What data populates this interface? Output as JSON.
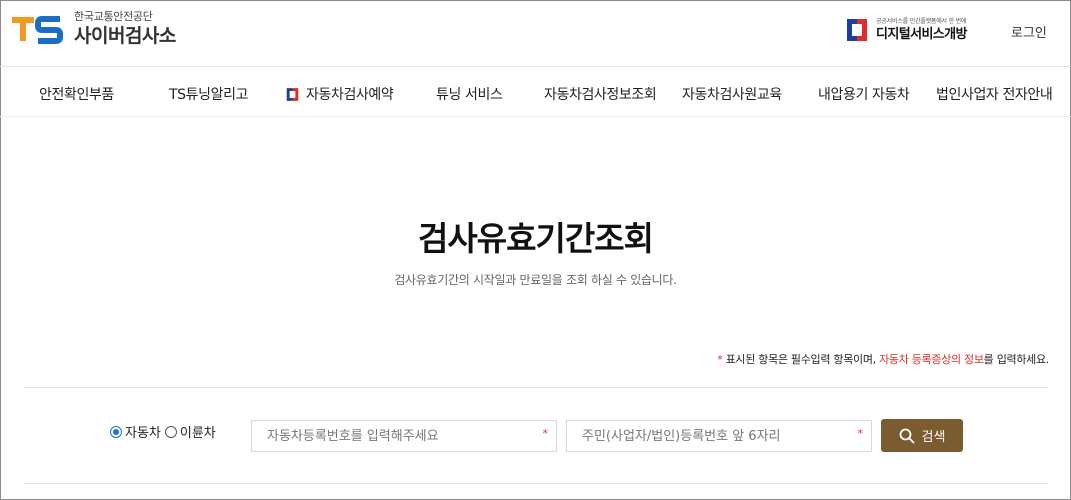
{
  "header": {
    "logo_mark": "TS",
    "org_name": "한국교통안전공단",
    "site_name": "사이버검사소",
    "digital_tagline": "공공서비스를 민간플랫폼에서 한 번에",
    "digital_name": "디지털서비스개방",
    "login_label": "로그인"
  },
  "nav": {
    "items": [
      {
        "label": "안전확인부품"
      },
      {
        "label": "TS튜닝알리고"
      },
      {
        "label": "자동차검사예약",
        "icon": "digital-service-icon"
      },
      {
        "label": "튜닝 서비스"
      },
      {
        "label": "자동차검사정보조회"
      },
      {
        "label": "자동차검사원교육"
      },
      {
        "label": "내압용기 자동차"
      },
      {
        "label": "법인사업자 전자안내"
      }
    ]
  },
  "main": {
    "title": "검사유효기간조회",
    "subtitle": "검사유효기간의 시작일과 만료일을 조회 하실 수 있습니다.",
    "notice": {
      "star": "*",
      "text_before": " 표시된 항목은 필수입력 항목이며, ",
      "highlight": "자동차 등록증상의 정보",
      "text_after": "를 입력하세요."
    }
  },
  "form": {
    "vehicle_types": [
      {
        "label": "자동차",
        "checked": true
      },
      {
        "label": "이륜차",
        "checked": false
      }
    ],
    "car_number": {
      "placeholder": "자동차등록번호를 입력해주세요",
      "value": "",
      "required_mark": "*"
    },
    "id_number": {
      "placeholder": "주민(사업자/법인)등록번호 앞 6자리",
      "value": "",
      "required_mark": "*"
    },
    "search_label": "검색"
  },
  "colors": {
    "brand_orange": "#f29a1f",
    "brand_blue": "#1a6fc4",
    "search_button": "#7b5b30",
    "required_red": "#d9322e",
    "radio_accent": "#1a73e8"
  }
}
